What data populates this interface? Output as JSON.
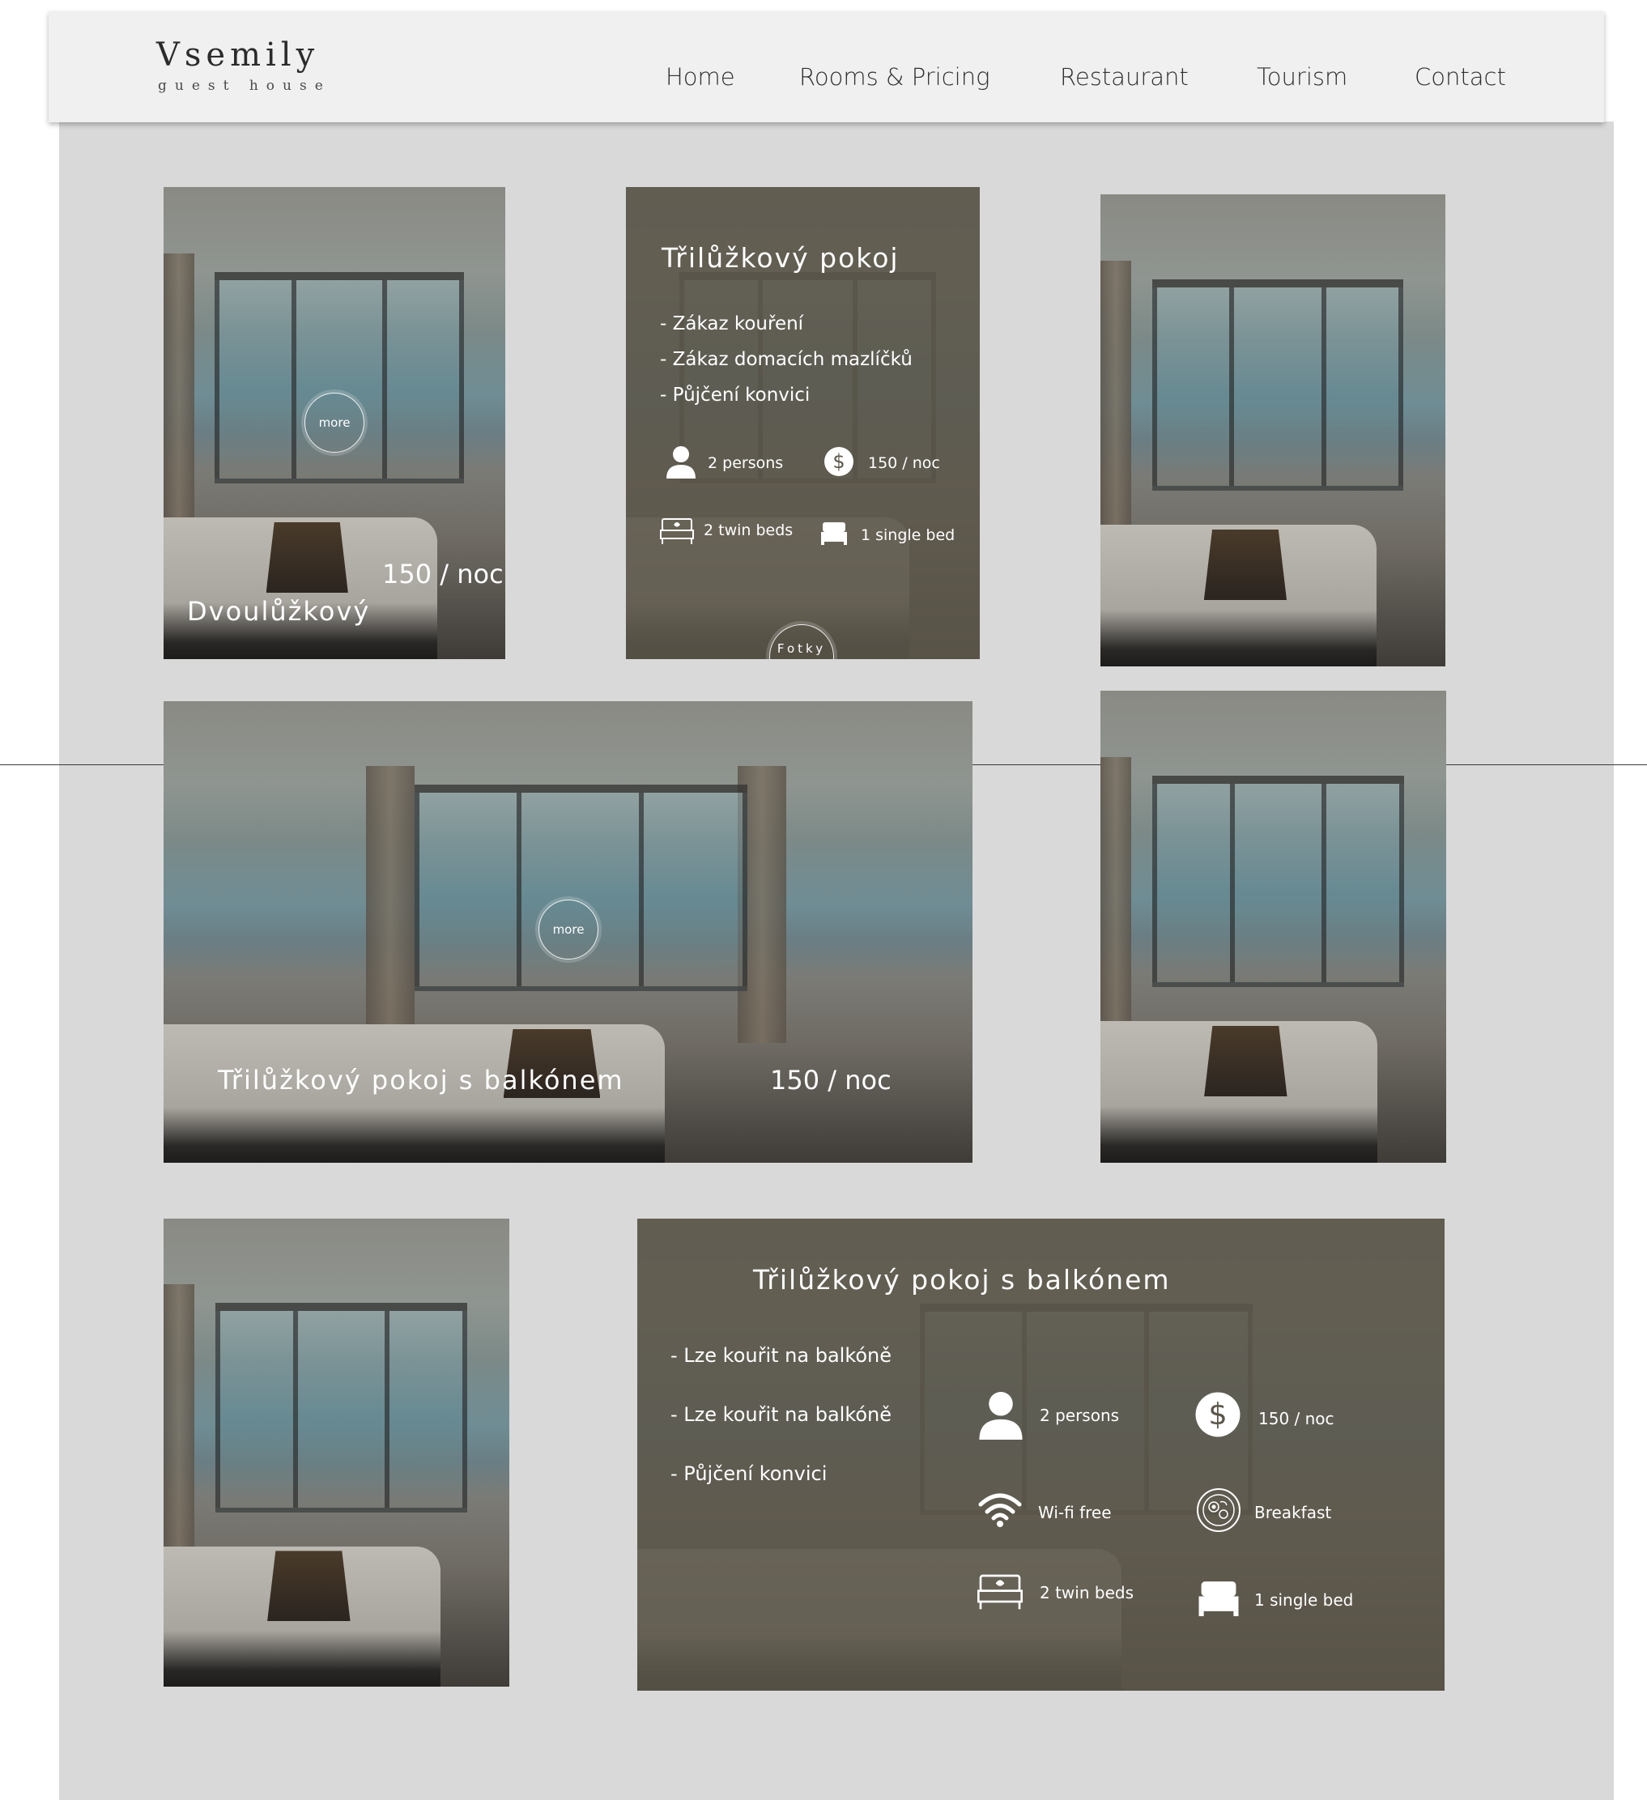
{
  "logo": {
    "name": "Vsemily",
    "subtitle": "guest house"
  },
  "nav": [
    {
      "label": "Home"
    },
    {
      "label": "Rooms & Pricing"
    },
    {
      "label": "Restaurant"
    },
    {
      "label": "Tourism"
    },
    {
      "label": "Contact"
    }
  ],
  "card1": {
    "more": "more",
    "price": "150 / noc",
    "title": "Dvoulůžkový"
  },
  "card2": {
    "title": "Třilůžkový pokoj",
    "features": [
      "- Zákaz kouření",
      "- Zákaz domacích mazlíčků",
      "- Půjčení konvici"
    ],
    "persons": "2 persons",
    "price": "150 / noc",
    "beds": "2 twin beds",
    "single": "1 single bed",
    "photos_button": "Fotky"
  },
  "card4": {
    "more": "more",
    "title": "Třilůžkový pokoj s balkónem",
    "price": "150 / noc"
  },
  "card7": {
    "title": "Třilůžkový pokoj s balkónem",
    "features": [
      "- Lze kouřit na balkóně",
      "- Lze kouřit na balkóně",
      "- Půjčení konvici"
    ],
    "persons": "2 persons",
    "price": "150 / noc",
    "wifi": "Wi-fi free",
    "breakfast": "Breakfast",
    "beds": "2 twin beds",
    "single": "1 single bed"
  },
  "icons": [
    "person-icon",
    "dollar-icon",
    "twin-bed-icon",
    "single-bed-icon",
    "wifi-icon",
    "breakfast-icon"
  ]
}
